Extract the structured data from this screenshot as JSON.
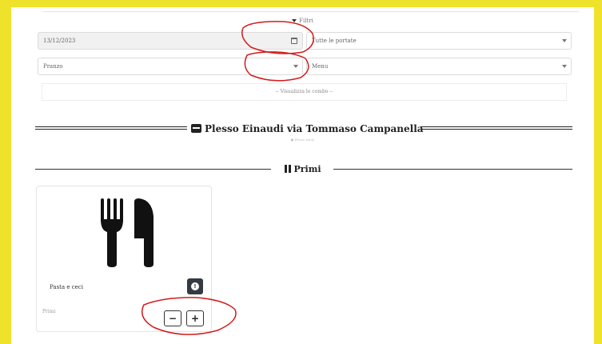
{
  "filters": {
    "title": "Filtri",
    "date_value": "13/12/2023",
    "course_select": "Tutte le portate",
    "meal_select": "Pranzo",
    "menu_select": "Menu",
    "combo_button": "-- Visualizza le combo --"
  },
  "venue": {
    "name": "Plesso Einaudi via Tommaso Campanella",
    "subtitle": "● Plesso titolo"
  },
  "section": {
    "title": "Primi"
  },
  "dish": {
    "name": "Pasta e ceci",
    "category": "Primi",
    "info_icon": "info-icon",
    "minus_label": "−",
    "plus_label": "+"
  },
  "colors": {
    "frame": "#efe22a",
    "annotation": "#d21c1c",
    "dark_button": "#343a40"
  }
}
